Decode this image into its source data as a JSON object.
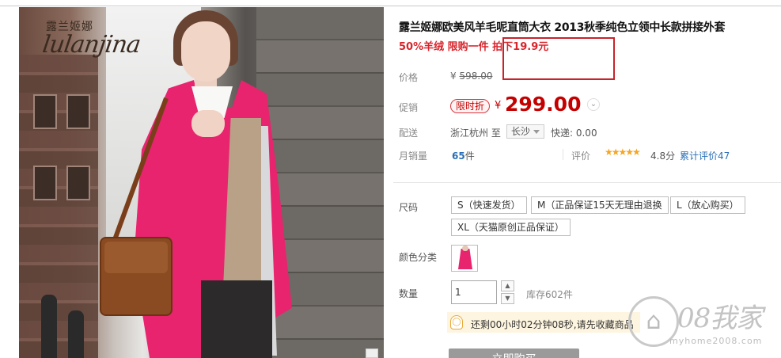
{
  "brand": {
    "name_cn": "露兰姬娜",
    "name_en": "lulanjina"
  },
  "product": {
    "title": "露兰姬娜欧美风羊毛呢直筒大衣 2013秋季纯色立领中长款拼接外套",
    "subtitle": "50%羊绒 限购一件 拍下19.9元"
  },
  "price": {
    "label": "价格",
    "currency": "¥",
    "original": "598.00"
  },
  "promo": {
    "label": "促销",
    "badge": "限时折",
    "currency": "¥",
    "price": "299.00",
    "expand_icon": "chevron-down-icon"
  },
  "shipping": {
    "label": "配送",
    "from": "浙江杭州 至",
    "to": "长沙",
    "express": "快递: 0.00"
  },
  "sales": {
    "label": "月销量",
    "count": "65",
    "unit": "件",
    "review_label": "评价",
    "stars": "★★★★★",
    "rating": "4.8分",
    "review_count": "累计评价47"
  },
  "size": {
    "label": "尺码",
    "options": [
      "S（快速发货）",
      "M（正品保证15天无理由退换",
      "L（放心购买）",
      "XL（天猫原创正品保证）"
    ]
  },
  "color": {
    "label": "颜色分类"
  },
  "quantity": {
    "label": "数量",
    "value": "1",
    "up": "▲",
    "down": "▼",
    "stock": "库存602件"
  },
  "tip": {
    "icon": "lightbulb-icon",
    "text": "还剩00小时02分钟08秒,请先收藏商品"
  },
  "buy_button": {
    "label": "立即购买"
  },
  "watermark": {
    "logo": "⌂",
    "text": "08我家",
    "url": "myhome2008.com"
  },
  "colors": {
    "accent_red": "#c40000",
    "coat_pink": "#e8246e",
    "link_blue": "#2a6fb7"
  }
}
